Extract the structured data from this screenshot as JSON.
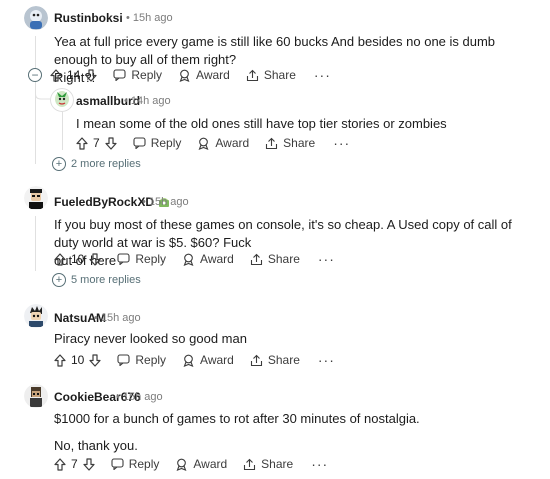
{
  "labels": {
    "reply": "Reply",
    "award": "Award",
    "share": "Share",
    "more": "···",
    "collapse": "−",
    "plus": "+",
    "dot": "•"
  },
  "comments": [
    {
      "author": "Rustinboksi",
      "time": "15h ago",
      "lines": [
        "Yea at full price every game is still like 60 bucks And besides no one is dumb enough to buy all of them right?",
        "Right?!"
      ],
      "votes": "14"
    },
    {
      "author": "asmallburd",
      "time": "14h ago",
      "lines": [
        "I mean some of the old ones still have top tier stories or zombies"
      ],
      "votes": "7"
    },
    {
      "author": "FueledByRockXD",
      "time": "15h ago",
      "lines": [
        "If you buy most of these games on console, it's so cheap. A Used copy of call of duty world at war is $5. $60? Fuck",
        "out of here"
      ],
      "votes": "10"
    },
    {
      "author": "NatsuAM",
      "time": "15h ago",
      "lines": [
        "Piracy never looked so good man"
      ],
      "votes": "10"
    },
    {
      "author": "CookieBear676",
      "time": "15h ago",
      "lines": [
        "$1000 for a bunch of games to rot after 30 minutes of nostalgia.",
        "No, thank you."
      ],
      "votes": "7"
    }
  ],
  "more_replies": [
    "2 more replies",
    "5 more replies"
  ],
  "colors": {
    "text": "#1c1c1c",
    "meta": "#7c7c7c",
    "thread": "#e0e0e0",
    "more_link": "#576f76"
  }
}
